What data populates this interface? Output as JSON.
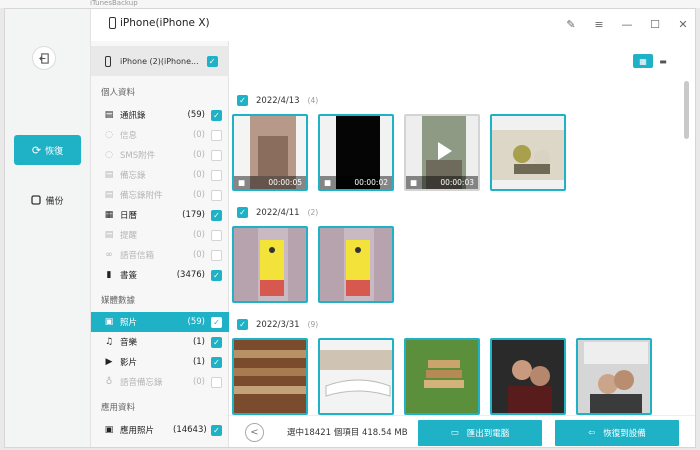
{
  "app": {
    "title": "iPhone(iPhone X)",
    "behind_text": "iTunesBackup"
  },
  "nav": {
    "items": [
      {
        "label": "恢復",
        "icon": "refresh-icon",
        "active": true
      },
      {
        "label": "備份",
        "icon": "backup-icon",
        "active": false
      }
    ]
  },
  "device": {
    "label": "iPhone (2)(iPhone..."
  },
  "sections": {
    "personal": "個人資料",
    "media": "媒體數據",
    "app": "應用資料"
  },
  "categories": [
    {
      "label": "通訊錄",
      "count": "(59)",
      "icon": "contacts-icon",
      "checked": true,
      "disabled": false
    },
    {
      "label": "信息",
      "count": "(0)",
      "icon": "message-icon",
      "checked": false,
      "disabled": true
    },
    {
      "label": "SMS附件",
      "count": "(0)",
      "icon": "sms-attachment-icon",
      "checked": false,
      "disabled": true
    },
    {
      "label": "備忘錄",
      "count": "(0)",
      "icon": "notes-icon",
      "checked": false,
      "disabled": true
    },
    {
      "label": "備忘錄附件",
      "count": "(0)",
      "icon": "notes-attachment-icon",
      "checked": false,
      "disabled": true
    },
    {
      "label": "日曆",
      "count": "(179)",
      "icon": "calendar-icon",
      "checked": true,
      "disabled": false
    },
    {
      "label": "提醒",
      "count": "(0)",
      "icon": "reminder-icon",
      "checked": false,
      "disabled": true
    },
    {
      "label": "語音信箱",
      "count": "(0)",
      "icon": "voicemail-icon",
      "checked": false,
      "disabled": true
    },
    {
      "label": "書簽",
      "count": "(3476)",
      "icon": "bookmark-icon",
      "checked": true,
      "disabled": false
    },
    {
      "label": "照片",
      "count": "(59)",
      "icon": "photo-icon",
      "checked": true,
      "disabled": false,
      "selected": true
    },
    {
      "label": "音樂",
      "count": "(1)",
      "icon": "music-icon",
      "checked": true,
      "disabled": false
    },
    {
      "label": "影片",
      "count": "(1)",
      "icon": "video-icon",
      "checked": true,
      "disabled": false
    },
    {
      "label": "語音備忘錄",
      "count": "(0)",
      "icon": "voice-memo-icon",
      "checked": false,
      "disabled": true
    },
    {
      "label": "應用照片",
      "count": "(14643)",
      "icon": "app-photo-icon",
      "checked": true,
      "disabled": false
    }
  ],
  "groups": [
    {
      "date": "2022/4/13",
      "count": "(4)",
      "durations": [
        "00:00:05",
        "00:00:02",
        "00:00:03",
        ""
      ]
    },
    {
      "date": "2022/4/11",
      "count": "(2)"
    },
    {
      "date": "2022/3/31",
      "count": "(9)"
    }
  ],
  "footer": {
    "summary": "選中18421 個項目 418.54 MB",
    "export_label": "匯出到電腦",
    "restore_label": "恢復到設備"
  },
  "colors": {
    "accent": "#1fb2c7"
  }
}
